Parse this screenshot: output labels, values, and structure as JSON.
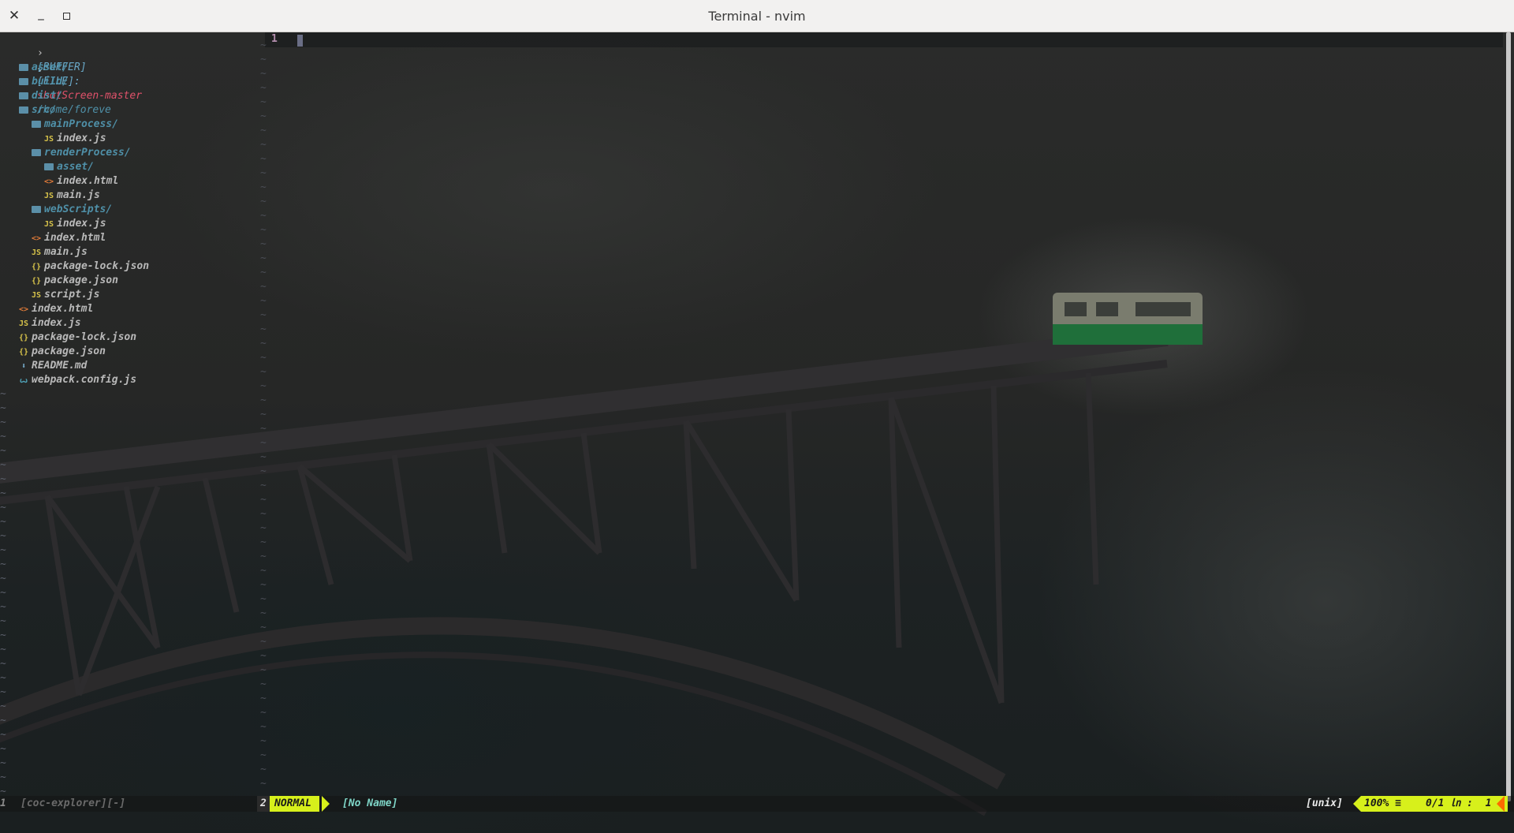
{
  "window": {
    "title": "Terminal - nvim",
    "close": "✕",
    "minimize": "_"
  },
  "explorer": {
    "buffer_label": "[BUFFER]",
    "file_label": "[FILE]:",
    "root_name": "shotScreen-master",
    "root_path": "/home/foreve",
    "tree": [
      {
        "name": "asset/",
        "type": "dir",
        "depth": 1
      },
      {
        "name": "build/",
        "type": "dir",
        "depth": 1
      },
      {
        "name": "dist/",
        "type": "dir",
        "depth": 1
      },
      {
        "name": "src/",
        "type": "dir",
        "depth": 1
      },
      {
        "name": "mainProcess/",
        "type": "dir",
        "depth": 2
      },
      {
        "name": "index.js",
        "type": "js",
        "depth": 3
      },
      {
        "name": "renderProcess/",
        "type": "dir",
        "depth": 2
      },
      {
        "name": "asset/",
        "type": "dir",
        "depth": 3
      },
      {
        "name": "index.html",
        "type": "html",
        "depth": 3
      },
      {
        "name": "main.js",
        "type": "js",
        "depth": 3
      },
      {
        "name": "webScripts/",
        "type": "dir",
        "depth": 2
      },
      {
        "name": "index.js",
        "type": "js",
        "depth": 3
      },
      {
        "name": "index.html",
        "type": "html",
        "depth": 2
      },
      {
        "name": "main.js",
        "type": "js",
        "depth": 2
      },
      {
        "name": "package-lock.json",
        "type": "json",
        "depth": 2
      },
      {
        "name": "package.json",
        "type": "json",
        "depth": 2
      },
      {
        "name": "script.js",
        "type": "js",
        "depth": 2
      },
      {
        "name": "index.html",
        "type": "html",
        "depth": 1
      },
      {
        "name": "index.js",
        "type": "js",
        "depth": 1
      },
      {
        "name": "package-lock.json",
        "type": "json",
        "depth": 1
      },
      {
        "name": "package.json",
        "type": "json",
        "depth": 1
      },
      {
        "name": "README.md",
        "type": "md",
        "depth": 1
      },
      {
        "name": "webpack.config.js",
        "type": "cfg",
        "depth": 1
      }
    ],
    "empty_line_marker": "~"
  },
  "editor": {
    "line_number": "1"
  },
  "statusline": {
    "left_win_num": "1",
    "left_buffer": "[coc-explorer][-]",
    "win_num": "2",
    "mode": "NORMAL",
    "file_name": "[No Name]",
    "fileformat": "[unix]",
    "percent": "100% ≡",
    "position": "0/1 ㏑ :  1"
  },
  "colors": {
    "mode_bg": "#d7f01b",
    "dir": "#4f90a8",
    "root_name": "#e0516a",
    "root_path": "#4f90a8",
    "line_number": "#b48ead"
  }
}
